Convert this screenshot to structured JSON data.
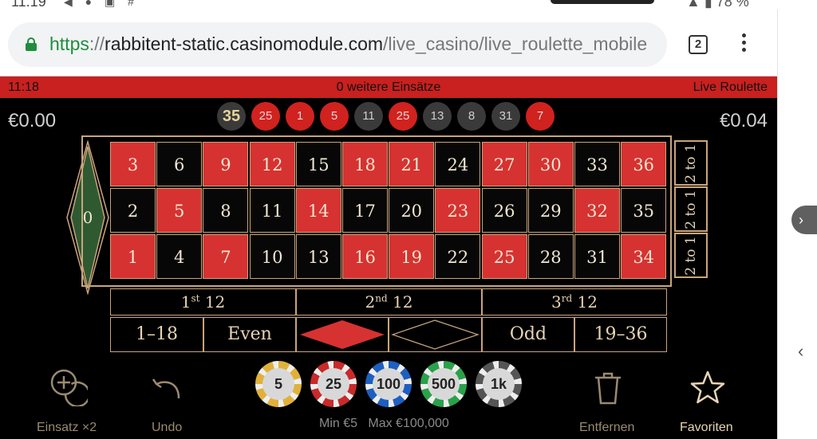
{
  "browser": {
    "url_scheme": "https",
    "url_separator": "://",
    "url_host": "rabbitent-static.casinomodule.com",
    "url_path": "/live_casino/live_roulette_mobile",
    "tab_count": "2"
  },
  "game": {
    "clock": "11:18",
    "bets_notice": "0 weitere Einsätze",
    "title": "Live Roulette",
    "balance_left": "€0.00",
    "balance_right": "€0.04",
    "history": [
      {
        "num": "35",
        "color": "black"
      },
      {
        "num": "25",
        "color": "red"
      },
      {
        "num": "1",
        "color": "red"
      },
      {
        "num": "5",
        "color": "red"
      },
      {
        "num": "11",
        "color": "black"
      },
      {
        "num": "25",
        "color": "red"
      },
      {
        "num": "13",
        "color": "black"
      },
      {
        "num": "8",
        "color": "black"
      },
      {
        "num": "31",
        "color": "black"
      },
      {
        "num": "7",
        "color": "red"
      }
    ],
    "zero_label": "0",
    "column_bets": [
      "2 to 1",
      "2 to 1",
      "2 to 1"
    ],
    "dozens": [
      {
        "ord": "1",
        "sup": "st",
        "val": "12"
      },
      {
        "ord": "2",
        "sup": "nd",
        "val": "12"
      },
      {
        "ord": "3",
        "sup": "rd",
        "val": "12"
      }
    ],
    "outside": [
      "1–18",
      "Even",
      "Odd",
      "19–36"
    ],
    "colors": {
      "red": "#d63231",
      "black": "#070707",
      "gold": "#c8a57c",
      "green": "#2f5a31"
    }
  },
  "controls": {
    "double_label": "Einsatz ×2",
    "undo_label": "Undo",
    "remove_label": "Entfernen",
    "favorites_label": "Favoriten",
    "min_bet": "Min €5",
    "max_bet": "Max €100,000",
    "chips": [
      {
        "value": "5",
        "color": "#e0b13a"
      },
      {
        "value": "25",
        "color": "#c92a2a"
      },
      {
        "value": "100",
        "color": "#1f5fc0"
      },
      {
        "value": "500",
        "color": "#2aa14a"
      },
      {
        "value": "1k",
        "color": "#555555"
      }
    ]
  }
}
